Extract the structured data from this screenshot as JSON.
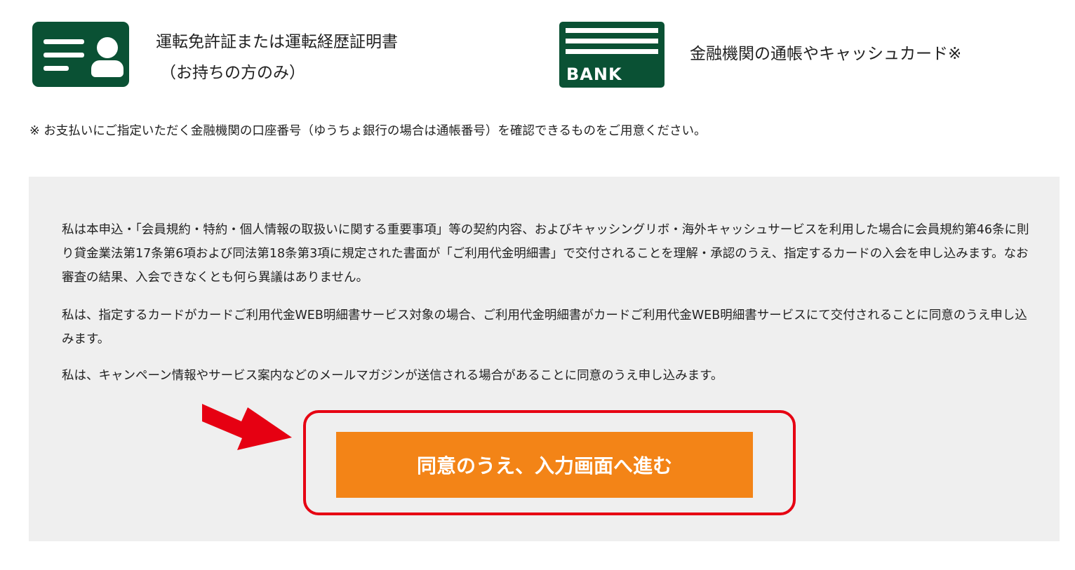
{
  "documents": {
    "license": {
      "icon": "id-card-icon",
      "label_line1": "運転免許証または運転経歴証明書",
      "label_line2": "（お持ちの方のみ）"
    },
    "bank": {
      "icon": "bank-passbook-icon",
      "icon_text": "BANK",
      "label": "金融機関の通帳やキャッシュカード※"
    }
  },
  "note": "※ お支払いにご指定いただく金融機関の口座番号（ゆうちょ銀行の場合は通帳番号）を確認できるものをご用意ください。",
  "consent": {
    "paragraphs": [
      "私は本申込・「会員規約・特約・個人情報の取扱いに関する重要事項」等の契約内容、およびキャッシングリボ・海外キャッシュサービスを利用した場合に会員規約第46条に則り貸金業法第17条第6項および同法第18条第3項に規定された書面が「ご利用代金明細書」で交付されることを理解・承認のうえ、指定するカードの入会を申し込みます。なお審査の結果、入会できなくとも何ら異議はありません。",
      "私は、指定するカードがカードご利用代金WEB明細書サービス対象の場合、ご利用代金明細書がカードご利用代金WEB明細書サービスにて交付されることに同意のうえ申し込みます。",
      "私は、キャンペーン情報やサービス案内などのメールマガジンが送信される場合があることに同意のうえ申し込みます。"
    ]
  },
  "proceed_button": {
    "label": "同意のうえ、入力画面へ進む"
  },
  "colors": {
    "icon_green": "#0a5134",
    "panel_gray": "#efefef",
    "button_orange": "#f38417",
    "highlight_red": "#e60012"
  }
}
